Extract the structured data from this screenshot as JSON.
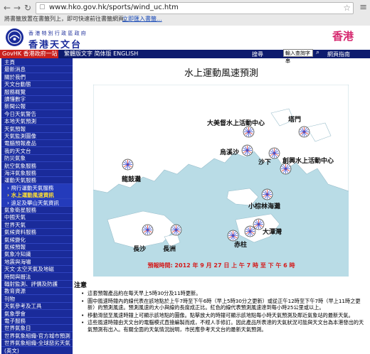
{
  "browser": {
    "url": "www.hko.gov.hk/sports/wind_uc.htm",
    "bookmarks_hint": "將書籤放置在書籤列上，即可快速前往書籤網頁。",
    "bookmarks_import": "立即匯入書籤..."
  },
  "header": {
    "org_small": "香 港 特 別 行 政 區 政 府",
    "org_big": "香港天文台",
    "brand": "香港"
  },
  "govbar": {
    "govhk": "GovHK 香港政府一站通",
    "langs": "繁體版文字  简体版  ENGLISH",
    "search_label": "搜尋",
    "search_placeholder": "輸入查詢字串",
    "webguide": "網頁指南"
  },
  "sidebar": {
    "items": [
      {
        "label": "主頁",
        "sub": false,
        "active": false
      },
      {
        "label": "最新消息",
        "sub": false,
        "active": false
      },
      {
        "label": "關於我們",
        "sub": false,
        "active": false
      },
      {
        "label": "天文台動態",
        "sub": false,
        "active": false
      },
      {
        "label": "服務概覽",
        "sub": false,
        "active": false
      },
      {
        "label": "讀懂數字",
        "sub": false,
        "active": false
      },
      {
        "label": "新聞公報",
        "sub": false,
        "active": false
      },
      {
        "label": "今日天氣警告",
        "sub": false,
        "active": false
      },
      {
        "label": "本地天氣預測",
        "sub": false,
        "active": false
      },
      {
        "label": "天氣預報",
        "sub": false,
        "active": false
      },
      {
        "label": "天氣監測圖像",
        "sub": false,
        "active": false
      },
      {
        "label": "電腦預報產品",
        "sub": false,
        "active": false
      },
      {
        "label": "我的天文台",
        "sub": false,
        "active": false
      },
      {
        "label": "防災氣象",
        "sub": false,
        "active": false
      },
      {
        "label": "航空氣象服務",
        "sub": false,
        "active": false
      },
      {
        "label": "海洋氣象服務",
        "sub": false,
        "active": false
      },
      {
        "label": "運動天氣服務",
        "sub": false,
        "active": false
      },
      {
        "label": "› 飛行運動天氣服務",
        "sub": true,
        "active": false
      },
      {
        "label": "› 水上運動風速資訊",
        "sub": true,
        "active": true
      },
      {
        "label": "› 遠足及攀山天氣資訊",
        "sub": true,
        "active": false
      },
      {
        "label": "氣象衛星服務",
        "sub": false,
        "active": false
      },
      {
        "label": "中國天氣",
        "sub": false,
        "active": false
      },
      {
        "label": "世界天氣",
        "sub": false,
        "active": false
      },
      {
        "label": "氣候資料服務",
        "sub": false,
        "active": false
      },
      {
        "label": "氣候變化",
        "sub": false,
        "active": false
      },
      {
        "label": "氣候預報",
        "sub": false,
        "active": false
      },
      {
        "label": "氣象冷知識",
        "sub": false,
        "active": false
      },
      {
        "label": "地震與海嘯",
        "sub": false,
        "active": false
      },
      {
        "label": "天文‧太空天氣及地磁",
        "sub": false,
        "active": false
      },
      {
        "label": "時間與曆法",
        "sub": false,
        "active": false
      },
      {
        "label": "輻射監測、評價及防護",
        "sub": false,
        "active": false
      },
      {
        "label": "教育資源",
        "sub": false,
        "active": false
      },
      {
        "label": "刊物",
        "sub": false,
        "active": false
      },
      {
        "label": "天氣參考及工具",
        "sub": false,
        "active": false
      },
      {
        "label": "氣象學會",
        "sub": false,
        "active": false
      },
      {
        "label": "電子服務",
        "sub": false,
        "active": false
      },
      {
        "label": "世界氣象日",
        "sub": false,
        "active": false
      },
      {
        "label": "世界氣象組織-官方城市預測",
        "sub": false,
        "active": false
      },
      {
        "label": "世界氣象組織-全球惡劣天氣",
        "sub": false,
        "active": false
      },
      {
        "label": "(英文)",
        "sub": false,
        "active": false
      }
    ]
  },
  "main": {
    "title": "水上運動風速預測",
    "validity": "預報時間: 2012 年 9 月 27 日 上 午 7 時 至 下 午 6 時",
    "map_labels": [
      {
        "text": "大美督水上活動中心"
      },
      {
        "text": "塔門"
      },
      {
        "text": "烏溪沙"
      },
      {
        "text": "沙下"
      },
      {
        "text": "創興水上活動中心"
      },
      {
        "text": "龍鼓灘"
      },
      {
        "text": "小棕林海灘"
      },
      {
        "text": "大潭灣"
      },
      {
        "text": "赤柱"
      },
      {
        "text": "長沙"
      },
      {
        "text": "長洲"
      }
    ],
    "notes_title": "注意",
    "notes": [
      "這套預報產品約在每天早上5時30分及11時更新。",
      "圖中風速時鐘內的線代表在該地點於上午7時至下午6時（早上5時30分之更新）或從正午12時至下午7時（早上11時之更新）的預測風速。預測風速的大小與線的長度成正比。紅色的線代表預測風速達到每小時25公里或以上。",
      "移動滑鼠至風速時鐘上可顯示該地點的圖像。點擊放大的時鐘可顯示該地點每小時天氣預測及鄰近氣象站的最新天氣。",
      "這些風速時鐘由天文台的電腦模式直接編製而成，不經人手修訂。因此產品所表達的天氣狀況可能與天文台為本港發出的天氣預測有出入。有關全面的天氣情況說明，市民應參考天文台的最新天氣預測。"
    ]
  },
  "colors": {
    "nav_blue": "#1a2b9a",
    "govhk_red": "#c9201d",
    "active_yellow": "#ffe033",
    "sea": "#b9dce6",
    "land": "#ffffff",
    "strong_wind": "#d41a1a",
    "brand_pink": "#d6286f"
  }
}
